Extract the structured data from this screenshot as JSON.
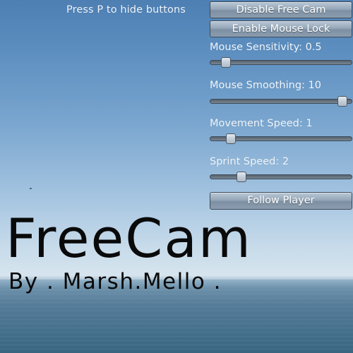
{
  "hint_text": "Press P to hide buttons",
  "buttons": {
    "disable_free_cam": "Disable Free Cam",
    "enable_mouse_lock": "Enable Mouse Lock",
    "follow_player": "Follow Player"
  },
  "sliders": [
    {
      "label": "Mouse Sensitivity: 0.5",
      "level": 0.08
    },
    {
      "label": "Mouse Smoothing: 10",
      "level": 0.97
    },
    {
      "label": "Movement Speed: 1",
      "level": 0.12
    },
    {
      "label": "Sprint Speed: 2",
      "level": 0.2
    }
  ],
  "overlay": {
    "title": "FreeCam",
    "byline": "By . Marsh.Mello ."
  },
  "colors": {
    "sky_top": "#4d7fb3",
    "horizon": "#d6e4ee",
    "sea": "#45708c",
    "button_gradient_top": "#b9c8d6",
    "button_gradient_bottom": "#8b9cad",
    "title_text": "#0a0a0a"
  }
}
